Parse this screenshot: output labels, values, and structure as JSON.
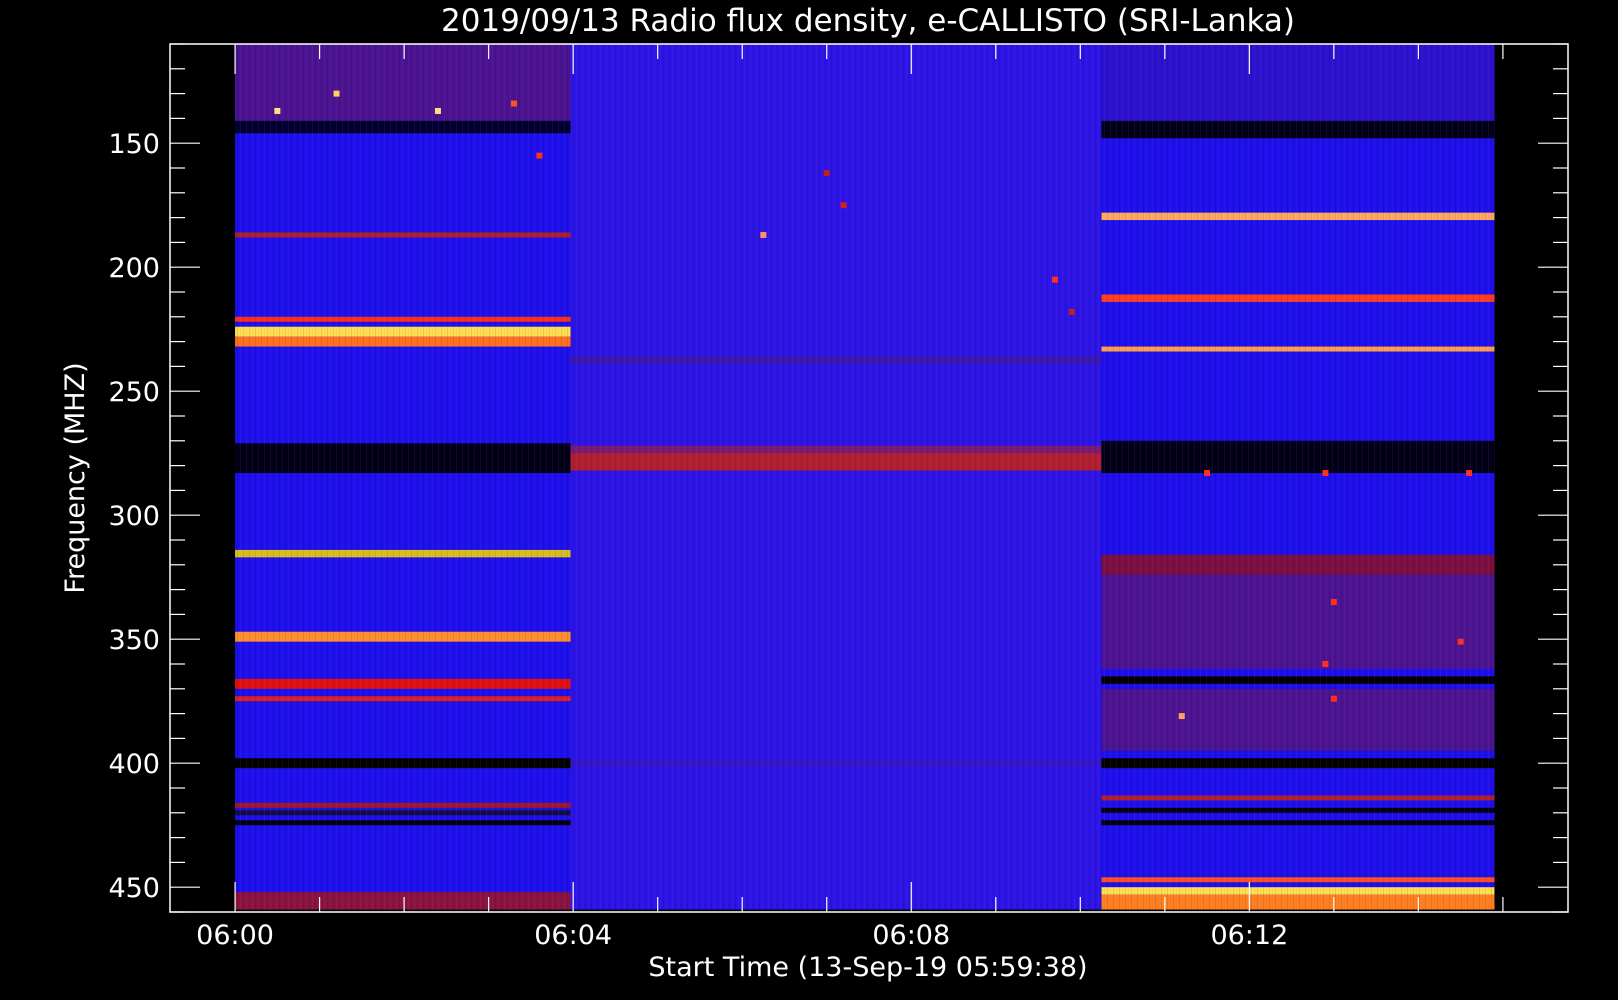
{
  "chart_data": {
    "type": "heatmap",
    "title": "2019/09/13  Radio flux density, e-CALLISTO (SRI-Lanka)",
    "xlabel": "Start Time (13-Sep-19 05:59:38)",
    "ylabel": "Frequency (MHZ)",
    "x_tick_labels": [
      "06:00",
      "06:04",
      "06:08",
      "06:12"
    ],
    "x_ticks_minutes": [
      0,
      4,
      8,
      12
    ],
    "x_range_minutes": [
      -0.77,
      15.77
    ],
    "data_x_range_minutes": [
      0.0,
      14.9
    ],
    "y_ticks": [
      150,
      200,
      250,
      300,
      350,
      400,
      450
    ],
    "ylim": [
      460,
      110
    ],
    "data_y_range": [
      108,
      459
    ],
    "segments": [
      {
        "t_start": 0.0,
        "t_end": 3.97,
        "base": "#1c10ee",
        "bands": [
          {
            "f0": 108,
            "f1": 141,
            "color": "#4a1392"
          },
          {
            "f0": 141,
            "f1": 146,
            "color": "#000030"
          },
          {
            "f0": 186,
            "f1": 188,
            "color": "#b0202a"
          },
          {
            "f0": 220,
            "f1": 222,
            "color": "#ff3018"
          },
          {
            "f0": 224,
            "f1": 228,
            "color": "#ffe050"
          },
          {
            "f0": 228,
            "f1": 232,
            "color": "#ff7020"
          },
          {
            "f0": 271,
            "f1": 283,
            "color": "#000018"
          },
          {
            "f0": 314,
            "f1": 317,
            "color": "#d8c020"
          },
          {
            "f0": 347,
            "f1": 351,
            "color": "#ff9030"
          },
          {
            "f0": 366,
            "f1": 370,
            "color": "#e01010"
          },
          {
            "f0": 373,
            "f1": 375,
            "color": "#e02020"
          },
          {
            "f0": 398,
            "f1": 402,
            "color": "#000000"
          },
          {
            "f0": 416,
            "f1": 418,
            "color": "#a01828"
          },
          {
            "f0": 419,
            "f1": 421,
            "color": "#101040"
          },
          {
            "f0": 423,
            "f1": 425,
            "color": "#000010"
          },
          {
            "f0": 452,
            "f1": 459,
            "color": "#8a1440"
          }
        ]
      },
      {
        "t_start": 3.97,
        "t_end": 10.25,
        "base": "#2a14e8",
        "bands": [
          {
            "f0": 236,
            "f1": 239,
            "color": "#3a18b0"
          },
          {
            "f0": 272,
            "f1": 275,
            "color": "#7a1a70"
          },
          {
            "f0": 275,
            "f1": 282,
            "color": "#b02030"
          },
          {
            "f0": 399,
            "f1": 401,
            "color": "#3a18c0"
          }
        ]
      },
      {
        "t_start": 10.25,
        "t_end": 14.9,
        "base": "#1c10ee",
        "bands": [
          {
            "f0": 108,
            "f1": 141,
            "color": "#2a12d0"
          },
          {
            "f0": 141,
            "f1": 148,
            "color": "#000018"
          },
          {
            "f0": 178,
            "f1": 181,
            "color": "#ffa860"
          },
          {
            "f0": 211,
            "f1": 214,
            "color": "#ff4020"
          },
          {
            "f0": 232,
            "f1": 234,
            "color": "#ffa050"
          },
          {
            "f0": 270,
            "f1": 283,
            "color": "#000018"
          },
          {
            "f0": 316,
            "f1": 324,
            "color": "#7a1040"
          },
          {
            "f0": 324,
            "f1": 362,
            "color": "#4a1492"
          },
          {
            "f0": 365,
            "f1": 368,
            "color": "#000000"
          },
          {
            "f0": 370,
            "f1": 395,
            "color": "#4a1492"
          },
          {
            "f0": 398,
            "f1": 402,
            "color": "#000000"
          },
          {
            "f0": 413,
            "f1": 415,
            "color": "#b02030"
          },
          {
            "f0": 418,
            "f1": 420,
            "color": "#000010"
          },
          {
            "f0": 423,
            "f1": 425,
            "color": "#000010"
          },
          {
            "f0": 446,
            "f1": 448,
            "color": "#ff5020"
          },
          {
            "f0": 450,
            "f1": 453,
            "color": "#ffe050"
          },
          {
            "f0": 453,
            "f1": 459,
            "color": "#ff8020"
          }
        ]
      }
    ],
    "spots": [
      {
        "t": 1.2,
        "f": 130,
        "color": "#ffd060"
      },
      {
        "t": 0.5,
        "f": 137,
        "color": "#ffe080"
      },
      {
        "t": 2.4,
        "f": 137,
        "color": "#ffe080"
      },
      {
        "t": 3.3,
        "f": 134,
        "color": "#ff5020"
      },
      {
        "t": 3.6,
        "f": 155,
        "color": "#ff3020"
      },
      {
        "t": 7.0,
        "f": 162,
        "color": "#c02020"
      },
      {
        "t": 7.2,
        "f": 175,
        "color": "#d02020"
      },
      {
        "t": 6.25,
        "f": 187,
        "color": "#ff9060"
      },
      {
        "t": 9.7,
        "f": 205,
        "color": "#ff3020"
      },
      {
        "t": 9.9,
        "f": 218,
        "color": "#c02020"
      },
      {
        "t": 11.5,
        "f": 283,
        "color": "#ff3020"
      },
      {
        "t": 12.9,
        "f": 283,
        "color": "#ff3020"
      },
      {
        "t": 14.6,
        "f": 283,
        "color": "#ff3020"
      },
      {
        "t": 13.0,
        "f": 335,
        "color": "#ff3020"
      },
      {
        "t": 12.9,
        "f": 360,
        "color": "#ff3020"
      },
      {
        "t": 14.5,
        "f": 351,
        "color": "#ff3020"
      },
      {
        "t": 13.0,
        "f": 374,
        "color": "#ff3020"
      },
      {
        "t": 11.2,
        "f": 381,
        "color": "#ffa060"
      }
    ],
    "grid": false,
    "legend": "none",
    "colors": {
      "background": "#000000",
      "foreground": "#ffffff"
    }
  }
}
